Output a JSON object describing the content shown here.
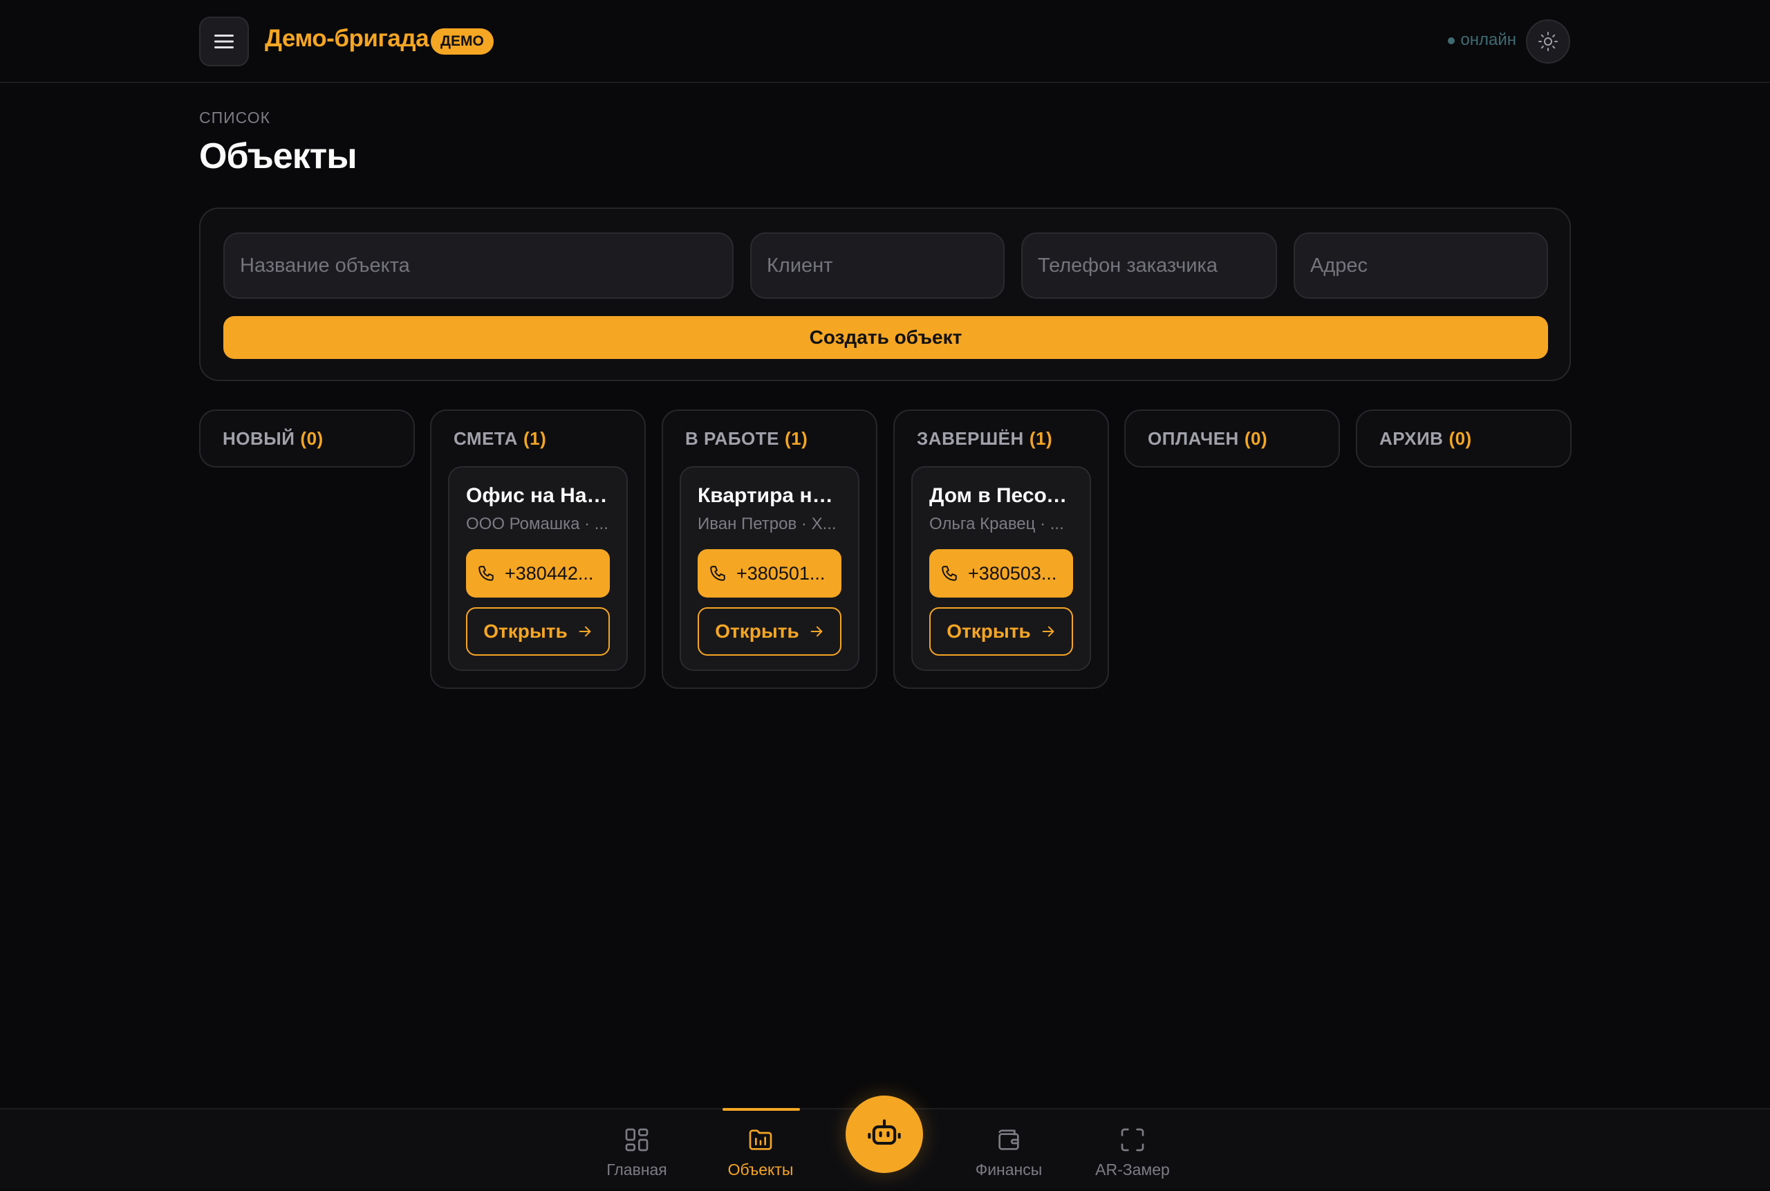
{
  "header": {
    "brand": "Демо-бригада",
    "badge": "ДЕМО",
    "status": "онлайн",
    "menu_icon": "hamburger-menu-icon",
    "theme_icon": "sun-icon"
  },
  "page": {
    "eyebrow": "СПИСОК",
    "title": "Объекты"
  },
  "form": {
    "name_placeholder": "Название объекта",
    "client_placeholder": "Клиент",
    "phone_placeholder": "Телефон заказчика",
    "address_placeholder": "Адрес",
    "submit_label": "Создать объект"
  },
  "columns": [
    {
      "label": "НОВЫЙ",
      "count": "(0)"
    },
    {
      "label": "СМЕТА",
      "count": "(1)"
    },
    {
      "label": "В РАБОТЕ",
      "count": "(1)"
    },
    {
      "label": "ЗАВЕРШЁН",
      "count": "(1)"
    },
    {
      "label": "ОПЛАЧЕН",
      "count": "(0)"
    },
    {
      "label": "АРХИВ",
      "count": "(0)"
    }
  ],
  "cards": [
    {
      "title": "Офис на Науки",
      "subtitle": "ООО Ромашка · ...",
      "phone": "+380442...",
      "open_label": "Открыть"
    },
    {
      "title": "Квартира на ...",
      "subtitle": "Иван Петров · Х...",
      "phone": "+380501...",
      "open_label": "Открыть"
    },
    {
      "title": "Дом в Песочи...",
      "subtitle": "Ольга Кравец · ...",
      "phone": "+380503...",
      "open_label": "Открыть"
    }
  ],
  "nav": {
    "home": "Главная",
    "objects": "Объекты",
    "finance": "Финансы",
    "ar": "AR-Замер",
    "assistant_icon": "robot-icon"
  },
  "colors": {
    "accent": "#f5a623",
    "background": "#09090b",
    "status": "#3f6b72"
  }
}
